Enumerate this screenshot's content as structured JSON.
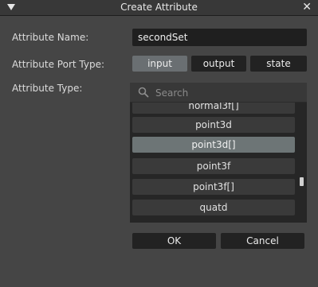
{
  "window": {
    "title": "Create Attribute",
    "close_symbol": "✕"
  },
  "form": {
    "name_label": "Attribute Name:",
    "name_value": "secondSet",
    "port_type_label": "Attribute Port Type:",
    "port_types": [
      {
        "label": "input",
        "selected": true
      },
      {
        "label": "output",
        "selected": false
      },
      {
        "label": "state",
        "selected": false
      }
    ],
    "attr_type_label": "Attribute Type:",
    "search_placeholder": "Search",
    "type_list": [
      {
        "label": "normal3f[]",
        "selected": false
      },
      {
        "label": "point3d",
        "selected": false
      },
      {
        "label": "point3d[]",
        "selected": true
      },
      {
        "label": "point3f",
        "selected": false
      },
      {
        "label": "point3f[]",
        "selected": false
      },
      {
        "label": "quatd",
        "selected": false
      }
    ]
  },
  "buttons": {
    "ok_label": "OK",
    "cancel_label": "Cancel"
  },
  "colors": {
    "window_bg": "#454545",
    "titlebar_bg": "#383838",
    "selected_port": "#6a6f72",
    "selected_item": "#6d7576"
  },
  "icons": {
    "title_menu": "triangle-down-icon",
    "close": "close-icon",
    "search": "search-icon"
  }
}
